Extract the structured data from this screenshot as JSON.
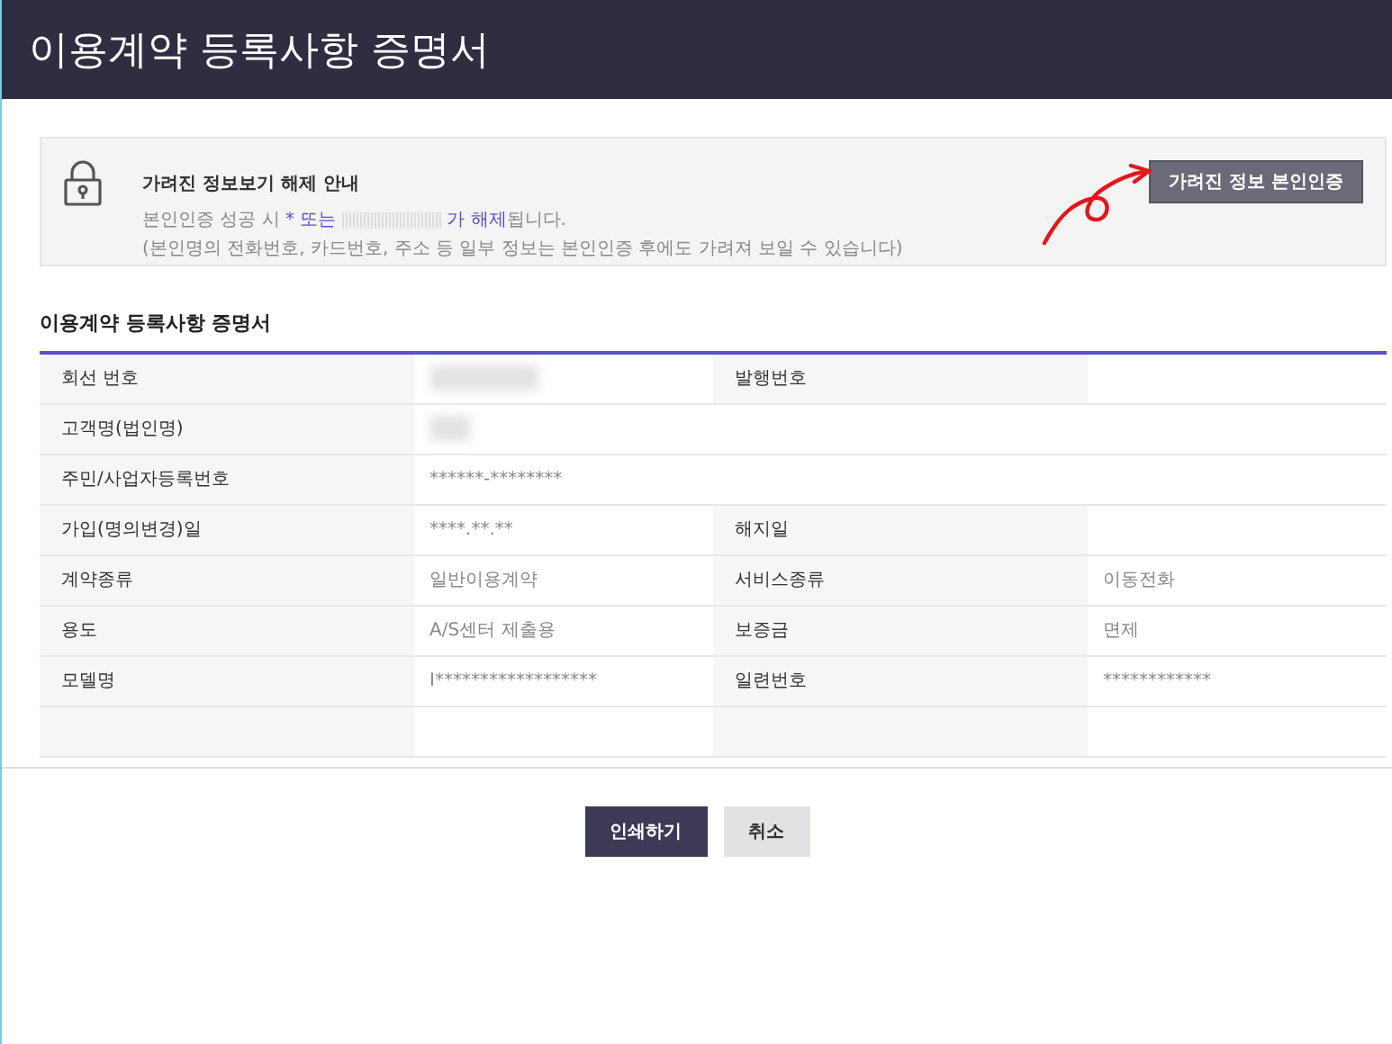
{
  "window": {
    "title": "이용계약 등록사항 증명서"
  },
  "notice": {
    "title": "가려진 정보보기 해제 안내",
    "line1": [
      {
        "kind": "plain",
        "text": "본인인증 성공 시 "
      },
      {
        "kind": "highlight",
        "text": "* 또는 "
      },
      {
        "kind": "masked"
      },
      {
        "kind": "highlight",
        "text": " 가 해제"
      },
      {
        "kind": "plain",
        "text": "됩니다."
      }
    ],
    "line2": "(본인명의 전화번호, 카드번호, 주소 등 일부 정보는 본인인증 후에도 가려져 보일 수 있습니다)",
    "button": "가려진 정보 본인인증"
  },
  "section_title": "이용계약 등록사항 증명서",
  "rows": [
    {
      "label": "회선 번호",
      "value": {
        "kind": "blurred"
      },
      "label2": "발행번호",
      "value2": ""
    },
    {
      "label": "고객명(법인명)",
      "value": {
        "kind": "blurred"
      }
    },
    {
      "label": "주민/사업자등록번호",
      "value": {
        "kind": "text",
        "text": "******-********"
      }
    },
    {
      "label": "가입(명의변경)일",
      "value": {
        "kind": "text",
        "text": "****.**.**"
      },
      "label2": "해지일",
      "value2": ""
    },
    {
      "label": "계약종류",
      "value": {
        "kind": "text",
        "text": "일반이용계약"
      },
      "label2": "서비스종류",
      "value2": "이동전화"
    },
    {
      "label": "용도",
      "value": {
        "kind": "text",
        "text": "A/S센터 제출용"
      },
      "label2": "보증금",
      "value2": "면제"
    },
    {
      "label": "모델명",
      "value": {
        "kind": "text",
        "text": "I******************"
      },
      "label2": "일련번호",
      "value2": "************"
    }
  ],
  "buttons": [
    {
      "label": "인쇄하기",
      "kind": "primary"
    },
    {
      "label": "취소",
      "kind": "secondary"
    }
  ]
}
